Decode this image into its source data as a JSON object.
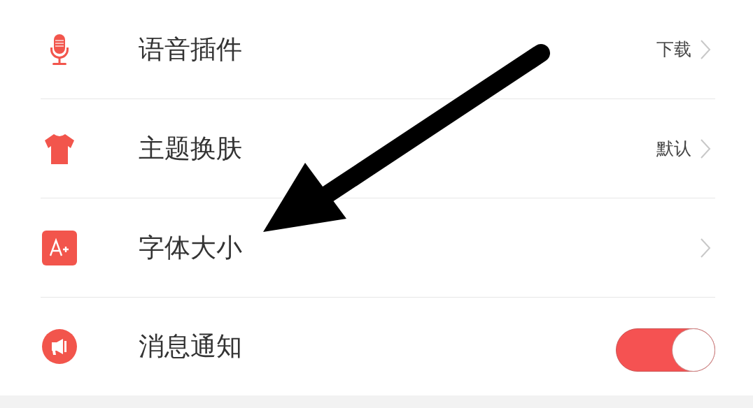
{
  "settings": [
    {
      "kind": "link",
      "label": "语音插件",
      "value": "下载"
    },
    {
      "kind": "link",
      "label": "主题换肤",
      "value": "默认"
    },
    {
      "kind": "link",
      "label": "字体大小"
    },
    {
      "kind": "toggle",
      "label": "消息通知",
      "on": true
    }
  ]
}
